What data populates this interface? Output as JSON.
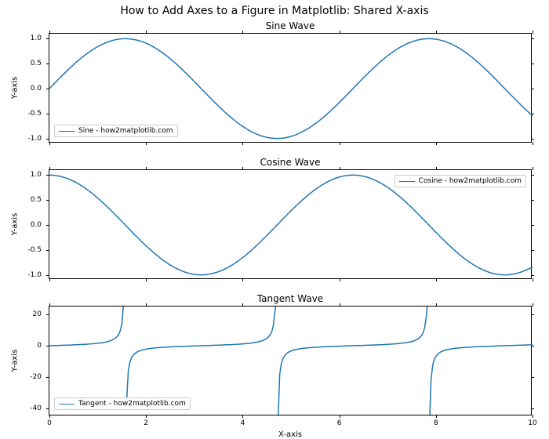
{
  "suptitle": "How to Add Axes to a Figure in Matplotlib: Shared X-axis",
  "xlabel": "X-axis",
  "ylabel": "Y-axis",
  "x_ticks": [
    0,
    2,
    4,
    6,
    8,
    10
  ],
  "panels": [
    {
      "title": "Sine Wave",
      "legend_label": "Sine - how2matplotlib.com",
      "legend_pos": "lower-left",
      "y_ticks": [
        -1.0,
        -0.5,
        0.0,
        0.5,
        1.0
      ],
      "ylim": [
        -1.1,
        1.1
      ]
    },
    {
      "title": "Cosine Wave",
      "legend_label": "Cosine - how2matplotlib.com",
      "legend_pos": "upper-right",
      "y_ticks": [
        -1.0,
        -0.5,
        0.0,
        0.5,
        1.0
      ],
      "ylim": [
        -1.1,
        1.1
      ]
    },
    {
      "title": "Tangent Wave",
      "legend_label": "Tangent - how2matplotlib.com",
      "legend_pos": "lower-left",
      "y_ticks": [
        -40,
        -20,
        0,
        20
      ],
      "ylim": [
        -45,
        25
      ]
    }
  ],
  "chart_data": [
    {
      "type": "line",
      "title": "Sine Wave",
      "xlabel": "X-axis",
      "ylabel": "Y-axis",
      "xlim": [
        0,
        10
      ],
      "ylim": [
        -1.1,
        1.1
      ],
      "series": [
        {
          "name": "Sine - how2matplotlib.com",
          "function": "sin(x)"
        }
      ]
    },
    {
      "type": "line",
      "title": "Cosine Wave",
      "xlabel": "X-axis",
      "ylabel": "Y-axis",
      "xlim": [
        0,
        10
      ],
      "ylim": [
        -1.1,
        1.1
      ],
      "series": [
        {
          "name": "Cosine - how2matplotlib.com",
          "function": "cos(x)"
        }
      ]
    },
    {
      "type": "line",
      "title": "Tangent Wave",
      "xlabel": "X-axis",
      "ylabel": "Y-axis",
      "xlim": [
        0,
        10
      ],
      "ylim": [
        -45,
        25
      ],
      "series": [
        {
          "name": "Tangent - how2matplotlib.com",
          "function": "tan(x)"
        }
      ]
    }
  ],
  "colors": {
    "line": "#1f77b4"
  }
}
